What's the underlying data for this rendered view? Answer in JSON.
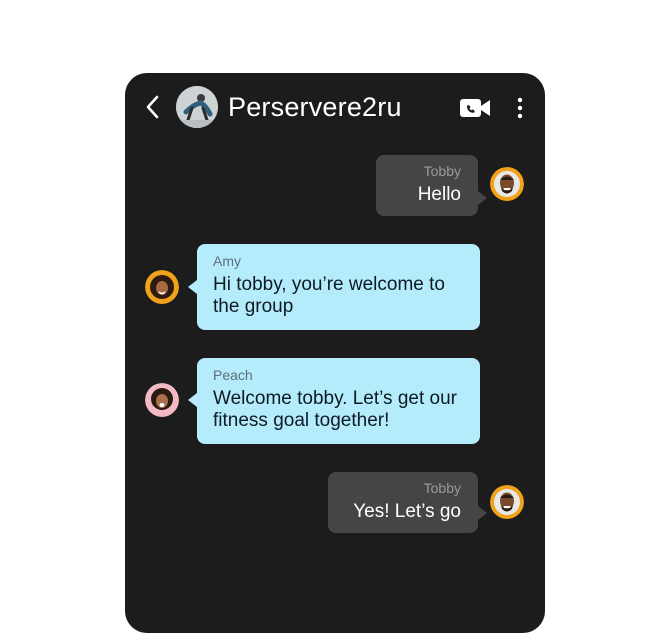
{
  "header": {
    "title": "Perservere2ru",
    "icons": [
      "chevron-left-icon",
      "group-avatar",
      "video-call-icon",
      "more-vertical-icon"
    ]
  },
  "messages": [
    {
      "sender": "Tobby",
      "text": "Hello",
      "direction": "outgoing"
    },
    {
      "sender": "Amy",
      "text": "Hi tobby, you’re welcome to\nthe group",
      "direction": "incoming"
    },
    {
      "sender": "Peach",
      "text": "Welcome tobby. Let’s get our\nfitness goal together!",
      "direction": "incoming"
    },
    {
      "sender": "Tobby",
      "text": "Yes! Let’s go",
      "direction": "outgoing"
    }
  ],
  "colors": {
    "background": "#1c1c1c",
    "outgoing_bubble": "#454545",
    "incoming_bubble": "#b4ecfc",
    "avatar_ring": "#f0a21a"
  }
}
